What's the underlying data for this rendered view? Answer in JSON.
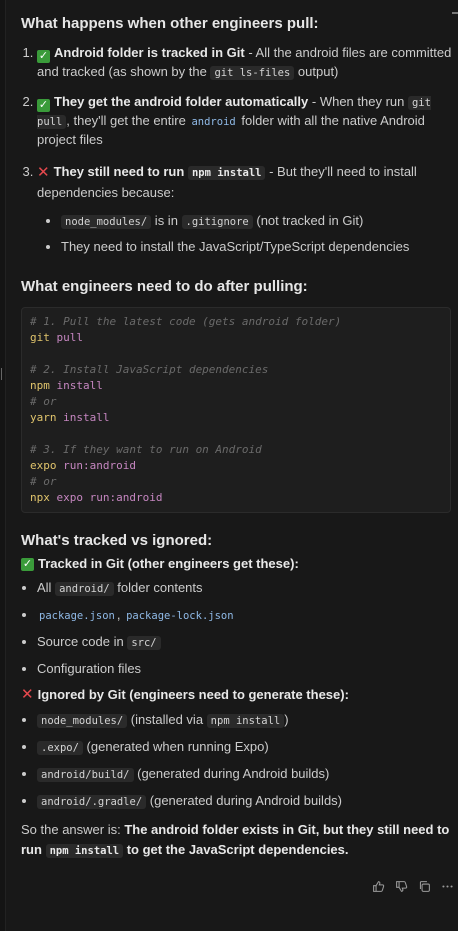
{
  "section1": {
    "heading": "What happens when other engineers pull:",
    "items": [
      {
        "bold": "Android folder is tracked in Git",
        "text1": " - All the android files are committed and tracked (as shown by the ",
        "code1": "git ls-files",
        "text2": " output)"
      },
      {
        "bold": "They get the android folder automatically",
        "text1": " - When they run ",
        "code1": "git pull",
        "text2": ", they'll get the entire ",
        "code2": "android",
        "text3": " folder with all the native Android project files"
      },
      {
        "bold": "They still need to run ",
        "boldcode": "npm install",
        "text1": " - But they'll need to install dependencies because:",
        "sub": [
          {
            "code": "node_modules/",
            "text1": " is in ",
            "code2": ".gitignore",
            "text2": " (not tracked in Git)"
          },
          {
            "text": "They need to install the JavaScript/TypeScript dependencies"
          }
        ]
      }
    ]
  },
  "section2": {
    "heading": "What engineers need to do after pulling:",
    "code": [
      {
        "comment": "# 1. Pull the latest code (gets android folder)"
      },
      {
        "cmd": "git",
        "arg": " pull"
      },
      {
        "blank": true
      },
      {
        "comment": "# 2. Install JavaScript dependencies"
      },
      {
        "cmd": "npm",
        "arg": " install"
      },
      {
        "comment": "# or"
      },
      {
        "cmd": "yarn",
        "arg": " install"
      },
      {
        "blank": true
      },
      {
        "comment": "# 3. If they want to run on Android"
      },
      {
        "cmd": "expo",
        "arg": " run:android"
      },
      {
        "comment": "# or"
      },
      {
        "cmd": "npx",
        "arg": " expo run:android"
      }
    ]
  },
  "section3": {
    "heading": "What's tracked vs ignored:",
    "tracked_title": "Tracked in Git (other engineers get these):",
    "tracked": [
      {
        "pre": "All ",
        "code": "android/",
        "post": " folder contents"
      },
      {
        "link1": "package.json",
        "sep": ", ",
        "link2": "package-lock.json"
      },
      {
        "pre": "Source code in ",
        "code": "src/",
        "post": ""
      },
      {
        "pre": "Configuration files"
      }
    ],
    "ignored_title": "Ignored by Git (engineers need to generate these):",
    "ignored": [
      {
        "code": "node_modules/",
        "mid": " (installed via ",
        "code2": "npm install",
        "post": ")"
      },
      {
        "code": ".expo/",
        "mid": " (generated when running Expo)"
      },
      {
        "code": "android/build/",
        "mid": " (generated during Android builds)"
      },
      {
        "code": "android/.gradle/",
        "mid": " (generated during Android builds)"
      }
    ]
  },
  "answer": {
    "pre": "So the answer is: ",
    "bold1": "The android folder exists in Git, but they still need to run ",
    "code": "npm install",
    "bold2": " to get the JavaScript dependencies."
  },
  "icons": [
    "thumbs-up-icon",
    "thumbs-down-icon",
    "copy-icon",
    "more-icon"
  ]
}
